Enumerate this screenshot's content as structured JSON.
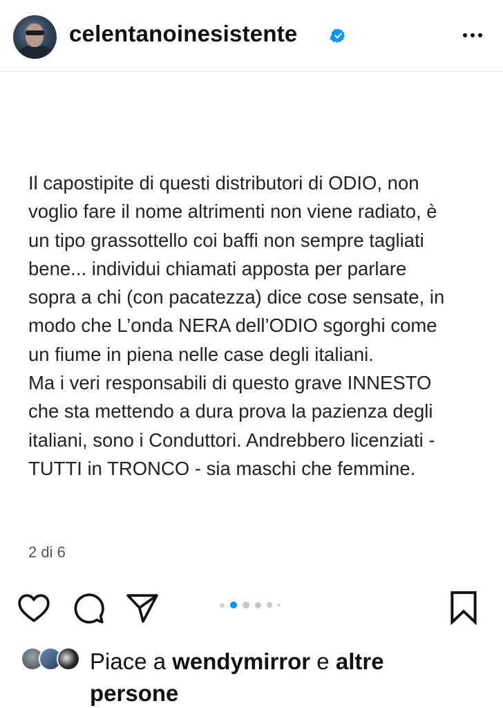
{
  "header": {
    "username": "celentanoinesistente",
    "verified": true,
    "more_icon": "more-horizontal-icon"
  },
  "post": {
    "lines": [
      "Il capostipite di questi distributori di ODIO, non",
      "voglio fare il nome altrimenti non viene radiato, è",
      "un tipo grassottello coi baffi non sempre tagliati",
      "bene... individui chiamati apposta per parlare",
      "sopra a chi (con pacatezza) dice cose sensate, in",
      "modo che L’onda NERA dell’ODIO sgorghi come",
      "un fiume in piena nelle case degli italiani.",
      "Ma i veri responsabili di questo grave INNESTO",
      "che sta mettendo a dura prova la pazienza degli",
      "italiani, sono i Conduttori. Andrebbero licenziati -",
      "TUTTI in TRONCO - sia maschi che femmine."
    ],
    "page_counter": "2 di 6"
  },
  "carousel": {
    "total_dots": 6,
    "active_index": 1,
    "active_color": "#0095f6"
  },
  "actions": {
    "like_icon": "heart-icon",
    "comment_icon": "comment-icon",
    "share_icon": "send-icon",
    "save_icon": "bookmark-icon"
  },
  "likes": {
    "prefix": "Piace a ",
    "user": "wendymirror",
    "conjunction": " e ",
    "others_line1": "altre",
    "others_line2": "persone"
  },
  "colors": {
    "verified": "#0095f6",
    "text": "#222222"
  }
}
